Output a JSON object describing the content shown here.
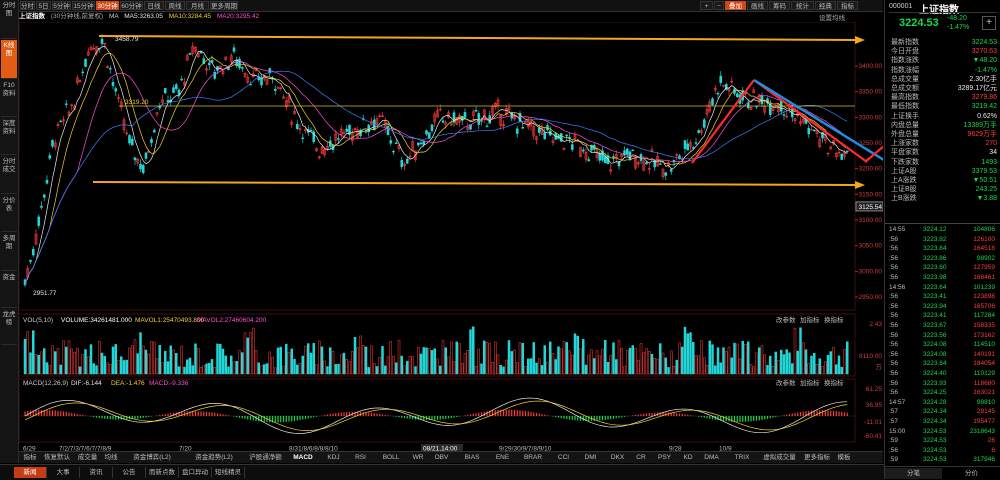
{
  "sidebar": {
    "tabs": [
      {
        "label": "分时图",
        "active": false
      },
      {
        "label": "K线图",
        "active": true
      },
      {
        "label": "F10资料",
        "active": false
      },
      {
        "label": "深度资料",
        "active": false
      },
      {
        "label": "分时成交",
        "active": false
      },
      {
        "label": "分价表",
        "active": false
      },
      {
        "label": "多周期",
        "active": false
      },
      {
        "label": "资金",
        "active": false
      },
      {
        "label": "龙虎榜",
        "active": false
      }
    ]
  },
  "toolbar": {
    "periods": [
      {
        "label": "分时",
        "active": false
      },
      {
        "label": "5日",
        "active": false
      },
      {
        "label": "5分钟",
        "active": false
      },
      {
        "label": "15分钟",
        "active": false
      },
      {
        "label": "30分钟",
        "active": true
      },
      {
        "label": "60分钟",
        "active": false
      },
      {
        "label": "日线",
        "active": false
      },
      {
        "label": "周线",
        "active": false
      },
      {
        "label": "月线",
        "active": false
      },
      {
        "label": "更多周期",
        "active": false
      }
    ],
    "right_buttons": [
      "+",
      "−",
      "叠加",
      "画线",
      "筹码",
      "统计",
      "经典",
      "指标"
    ],
    "overlay_label": "叠加"
  },
  "info": {
    "name": "上证指数",
    "mode": "(30分钟线,前复权)",
    "ma_prefix": "MA",
    "ma5": "MA5:3263.05",
    "ma10": "MA10:3284.45",
    "ma20": "MA20:3295.42",
    "setting": "设置均线"
  },
  "price_axis": {
    "ticks": [
      "3400.00",
      "3350.00",
      "3300.00",
      "3250.00",
      "3200.00",
      "3150.00",
      "3100.00",
      "3050.00",
      "3000.00",
      "2950.00"
    ],
    "marker_high": "3458.79",
    "marker_low": "2951.77",
    "mid_label": "3319.20",
    "current_tag": "3125.54"
  },
  "volume_panel": {
    "title": "VOL(5,10)",
    "volume": "VOLUME:34261481.000",
    "mavol1": "MAVOL1:25470493.800",
    "mavol2": "MAVOL2:27460604.200",
    "links": [
      "改参数",
      "加指标",
      "换指标"
    ],
    "axis": [
      "2.43",
      "8110.00",
      "万"
    ]
  },
  "macd_panel": {
    "title": "MACD(12,26,9)",
    "dif": "DIF:-6.144",
    "dea": "DEA:-1.476",
    "macd": "MACD:-9.336",
    "links": [
      "改参数",
      "加指标",
      "换指标"
    ],
    "axis": [
      "61.25",
      "36.95",
      "-11.01",
      "-60.41"
    ]
  },
  "date_axis": {
    "labels": [
      "6/29",
      "7/2/7/3/7/6/7/7/8/9",
      "7/20",
      "8/31/8/6/8/8/8/10",
      "08/21,14:00",
      "9/29/30/9/7/8/9/10",
      "9/28",
      "10/9"
    ]
  },
  "indicator_tabs": [
    "指标",
    "恢复默认",
    "成交量",
    "均线",
    "资金博弈(L2)",
    "资金趋势(L2)",
    "沪股通净额",
    "MACD",
    "KDJ",
    "RSI",
    "BOLL",
    "WR",
    "OBV",
    "BIAS",
    "ENE",
    "BRAR",
    "CCI",
    "DMI",
    "DKX",
    "CR",
    "PSY",
    "KD",
    "DMA",
    "TRIX",
    "虚拟成交量",
    "更多指标",
    "模板"
  ],
  "bottom_tabs": [
    {
      "label": "新闻",
      "active": true
    },
    {
      "label": "大事",
      "active": false
    },
    {
      "label": "资讯",
      "active": false
    },
    {
      "label": "公告",
      "active": false
    },
    {
      "label": "而新点数",
      "active": false
    },
    {
      "label": "盘口异动",
      "active": false
    },
    {
      "label": "短线精灵",
      "active": false
    }
  ],
  "quote": {
    "code": "000001",
    "name": "上证指数",
    "price": "3224.53",
    "change": "-48.20",
    "change_pct": "-1.47%",
    "fields": [
      {
        "label": "最新指数",
        "value": "3224.53",
        "color": "green"
      },
      {
        "label": "今日开盘",
        "value": "3270.63",
        "color": "red"
      },
      {
        "label": "指数涨跌",
        "value": "▼48.20",
        "color": "green"
      },
      {
        "label": "指数涨幅",
        "value": "-1.47%",
        "color": "green"
      },
      {
        "label": "总成交量",
        "value": "2.30亿手",
        "color": "white"
      },
      {
        "label": "总成交额",
        "value": "3289.17亿元",
        "color": "white"
      },
      {
        "label": "最高指数",
        "value": "3279.86",
        "color": "red"
      },
      {
        "label": "最低指数",
        "value": "3219.42",
        "color": "green"
      },
      {
        "label": "上证换手",
        "value": "0.62%",
        "color": "white"
      },
      {
        "label": "内盘总量",
        "value": "13389万手",
        "color": "green"
      },
      {
        "label": "外盘总量",
        "value": "9629万手",
        "color": "red"
      },
      {
        "label": "上涨家数",
        "value": "270",
        "color": "red"
      },
      {
        "label": "平盘家数",
        "value": "34",
        "color": "white"
      },
      {
        "label": "下跌家数",
        "value": "1493",
        "color": "green"
      },
      {
        "label": "上证A股",
        "value": "3379.53",
        "color": "green"
      },
      {
        "label": "上A涨跌",
        "value": "▼50.51",
        "color": "green"
      },
      {
        "label": "上证B股",
        "value": "243.25",
        "color": "green"
      },
      {
        "label": "上B涨跌",
        "value": "▼3.88",
        "color": "green"
      }
    ],
    "ticks": [
      {
        "time": "14:55",
        "price": "3224.12",
        "vol": "104806"
      },
      {
        "time": ":56",
        "price": "3223.82",
        "vol": "126100"
      },
      {
        "time": ":56",
        "price": "3223.84",
        "vol": "164518"
      },
      {
        "time": ":56",
        "price": "3223.86",
        "vol": "98902"
      },
      {
        "time": ":56",
        "price": "3223.60",
        "vol": "127959"
      },
      {
        "time": ":56",
        "price": "3223.98",
        "vol": "168461"
      },
      {
        "time": "14:56",
        "price": "3223.64",
        "vol": "101239"
      },
      {
        "time": ":56",
        "price": "3223.41",
        "vol": "123898"
      },
      {
        "time": ":56",
        "price": "3223.94",
        "vol": "165706"
      },
      {
        "time": ":56",
        "price": "3223.41",
        "vol": "117284"
      },
      {
        "time": ":56",
        "price": "3223.67",
        "vol": "158335"
      },
      {
        "time": ":56",
        "price": "3223.56",
        "vol": "173162"
      },
      {
        "time": ":56",
        "price": "3224.08",
        "vol": "114510"
      },
      {
        "time": ":56",
        "price": "3224.08",
        "vol": "140191"
      },
      {
        "time": ":56",
        "price": "3223.84",
        "vol": "184054"
      },
      {
        "time": ":56",
        "price": "3224.40",
        "vol": "110129"
      },
      {
        "time": ":56",
        "price": "3223.93",
        "vol": "118680"
      },
      {
        "time": ":56",
        "price": "3224.25",
        "vol": "163021"
      },
      {
        "time": "14:57",
        "price": "3224.28",
        "vol": "98810"
      },
      {
        "time": ":57",
        "price": "3224.34",
        "vol": "28145"
      },
      {
        "time": ":57",
        "price": "3224.34",
        "vol": "195477"
      },
      {
        "time": "15:00",
        "price": "3224.53",
        "vol": "2318643"
      },
      {
        "time": ":59",
        "price": "3224.53",
        "vol": "26"
      },
      {
        "time": ":56",
        "price": "3224.53",
        "vol": "6"
      },
      {
        "time": ":59",
        "price": "3224.53",
        "vol": "317946"
      }
    ],
    "footer_tabs": [
      "分笔",
      "分价"
    ]
  },
  "colors": {
    "up": "#ff3b3b",
    "down": "#18d84a",
    "accent": "#e35c14",
    "support_line": "#f2a81d",
    "down_trend": "#1e8fe6"
  }
}
